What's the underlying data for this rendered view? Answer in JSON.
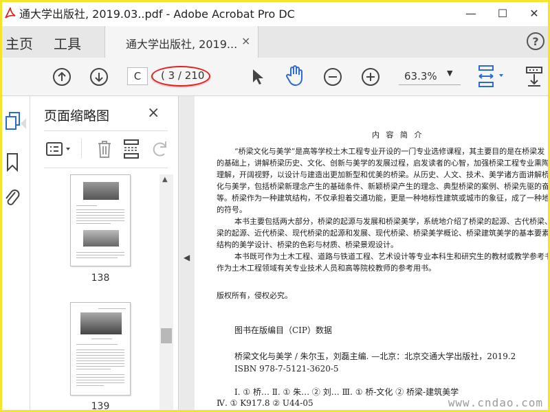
{
  "window": {
    "title": "通大学出版社, 2019.03..pdf - Adobe Acrobat Pro DC",
    "controls": [
      "minimize-icon",
      "maximize-icon",
      "close-icon"
    ]
  },
  "tabs": {
    "home": "主页",
    "tools": "工具",
    "document": "通大学出版社, 2019...",
    "document_close": "×"
  },
  "toolbar": {
    "page_input": "C",
    "page_count": "( 3 / 210",
    "zoom": "63.3%",
    "zoom_caret": "▼"
  },
  "thumbnails": {
    "panel_title": "页面缩略图",
    "close": "×",
    "pages": [
      {
        "label": "138"
      },
      {
        "label": "139"
      }
    ]
  },
  "document": {
    "heading": "内 容 简 介",
    "paragraphs": [
      "“桥梁文化与美学”是高等学校土木工程专业开设的一门专业选修课程，其主要目的是在桥梁发",
      "的基础上，讲解桥梁历史、文化、创新与美学的发展过程，启发读者的心智，加强桥梁工程专业熏陶和",
      "理解，开阔视野，以设计与建造出更加新型和优美的桥梁。从历史、人文、技术、美学诸方面讲解桥",
      "化与美学，包括桥梁新理念产生的基础条件、新颖桥梁产生的理念、典型桥梁的案例、桥梁先驱的奋",
      "等。桥梁作为一种建筑结构，不仅承担着交通功能，更是一种地标性建筑或城市的象征，成了一种地",
      "的符号。",
      "本书主要包括两大部分，桥梁的起源与发展和桥梁美学，系统地介绍了桥梁的起源、古代桥梁、",
      "梁的起源、近代桥梁、现代桥梁的起源和发展、现代桥梁、桥梁美学概论、桥梁建筑美学的基本要素、",
      "结构的美学设计、桥梁的色彩与材质、桥梁景观设计。",
      "本书既可作为土木工程、道路与铁道工程、艺术设计等专业本科生和研究生的教材或教学参考书，",
      "作为土木工程领域有关专业技术人员和高等院校教师的参考用书。"
    ],
    "rights": "版权所有，侵权必究。",
    "cip_title": "图书在版编目（CIP）数据",
    "cip_lines": [
      "桥梁文化与美学 / 朱尔玉，刘磊主编. —北京：北京交通大学出版社，2019.2",
      "ISBN 978-7-5121-3620-5",
      "Ⅰ. ① 桥…    Ⅱ. ① 朱…   ② 刘…    Ⅲ. ① 桥-文化    ② 桥梁-建筑美学",
      "Ⅳ. ① K917.8   ② U44-05"
    ],
    "watermark": "www.cndao.com"
  },
  "colors": {
    "accent_blue": "#2a6ad8",
    "highlight_red": "#d22222",
    "frame_yellow": "#f4e52a"
  }
}
